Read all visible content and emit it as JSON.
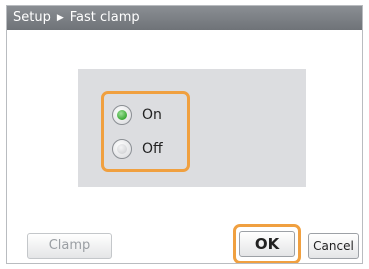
{
  "titlebar": {
    "parent": "Setup",
    "separator_icon": "right-triangle-icon",
    "current": "Fast clamp"
  },
  "options": [
    {
      "label": "On",
      "selected": true
    },
    {
      "label": "Off",
      "selected": false
    }
  ],
  "buttons": {
    "clamp": {
      "label": "Clamp",
      "enabled": false
    },
    "ok": {
      "label": "OK"
    },
    "cancel": {
      "label": "Cancel"
    }
  },
  "colors": {
    "highlight": "#f0a040",
    "selected_radio": "#3aa935",
    "titlebar": "#7d8186",
    "panel": "#dcdde0"
  }
}
